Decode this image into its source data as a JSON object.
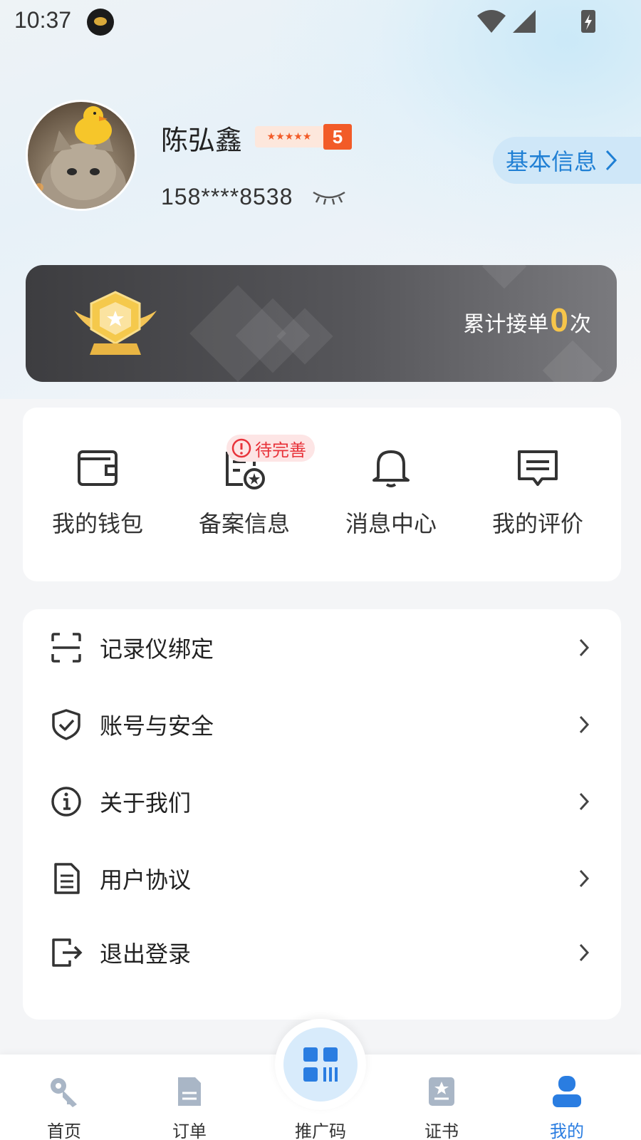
{
  "status_bar": {
    "time": "10:37"
  },
  "profile": {
    "name": "陈弘鑫",
    "stars": "★★★★★",
    "level": "5",
    "phone": "158****8538",
    "basic_info_label": "基本信息"
  },
  "stats": {
    "prefix": "累计接单",
    "count": "0",
    "suffix": "次"
  },
  "quick_actions": [
    {
      "label": "我的钱包",
      "icon": "wallet-icon"
    },
    {
      "label": "备案信息",
      "icon": "certificate-icon"
    },
    {
      "label": "消息中心",
      "icon": "bell-icon"
    },
    {
      "label": "我的评价",
      "icon": "comment-icon"
    }
  ],
  "pending_badge": "待完善",
  "menu": [
    {
      "label": "记录仪绑定",
      "icon": "scan-frame-icon"
    },
    {
      "label": "账号与安全",
      "icon": "shield-check-icon"
    },
    {
      "label": "关于我们",
      "icon": "info-icon"
    },
    {
      "label": "用户协议",
      "icon": "document-icon"
    },
    {
      "label": "退出登录",
      "icon": "logout-icon"
    }
  ],
  "bottom_nav": [
    {
      "label": "首页",
      "icon": "key-icon"
    },
    {
      "label": "订单",
      "icon": "order-icon"
    },
    {
      "label": "推广码",
      "icon": "qr-code-icon"
    },
    {
      "label": "证书",
      "icon": "certificate-badge-icon"
    },
    {
      "label": "我的",
      "icon": "user-icon",
      "active": true
    }
  ],
  "colors": {
    "accent": "#2a7de1",
    "warning": "#e8333a",
    "gold": "#f6c54a",
    "level_orange": "#f25b28"
  }
}
